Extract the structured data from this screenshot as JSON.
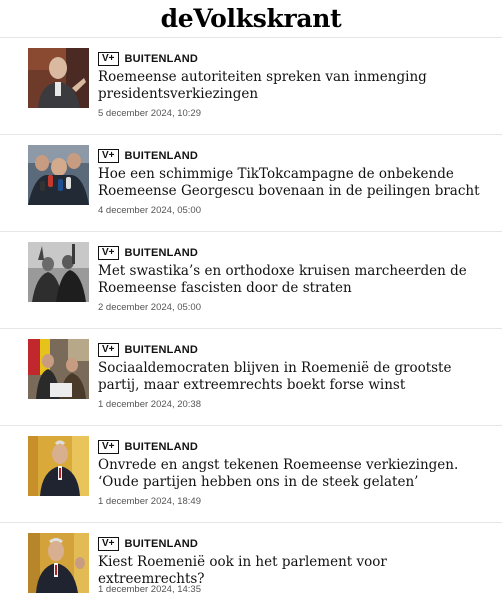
{
  "brand": {
    "logo_text": "deVolkskrant"
  },
  "articles": [
    {
      "badge": "V+",
      "section": "BUITENLAND",
      "title": "Roemeense autoriteiten spreken van inmenging presidentsverkiezingen",
      "date": "5 december 2024, 10:29"
    },
    {
      "badge": "V+",
      "section": "BUITENLAND",
      "title": "Hoe een schimmige TikTokcampagne de onbekende Roemeense Georgescu bovenaan in de peilingen bracht",
      "date": "4 december 2024, 05:00"
    },
    {
      "badge": "V+",
      "section": "BUITENLAND",
      "title": "Met swastika’s en orthodoxe kruisen marcheerden de Roemeense fascisten door de straten",
      "date": "2 december 2024, 05:00"
    },
    {
      "badge": "V+",
      "section": "BUITENLAND",
      "title": "Sociaaldemocraten blijven in Roemenië de grootste partij, maar extreemrechts boekt forse winst",
      "date": "1 december 2024, 20:38"
    },
    {
      "badge": "V+",
      "section": "BUITENLAND",
      "title": "Onvrede en angst tekenen Roemeense verkiezingen. ‘Oude partijen hebben ons in de steek gelaten’",
      "date": "1 december 2024, 18:49"
    },
    {
      "badge": "V+",
      "section": "BUITENLAND",
      "title": "Kiest Roemenië ook in het parlement voor extreemrechts?",
      "date": "1 december 2024, 14:35"
    }
  ]
}
